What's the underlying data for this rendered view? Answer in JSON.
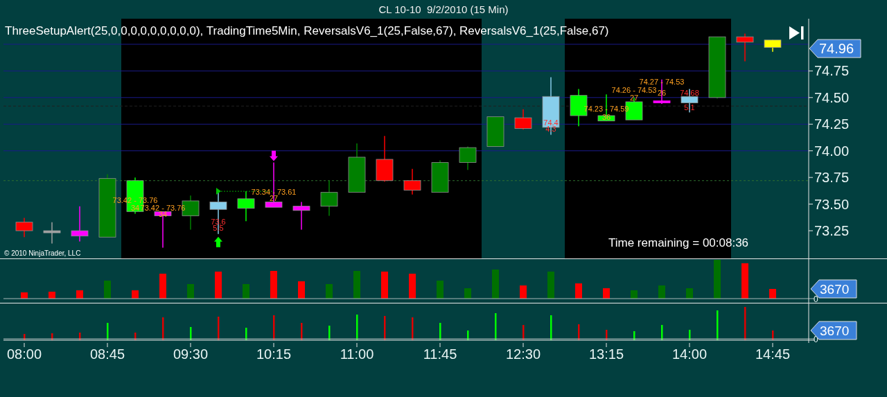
{
  "window": {
    "title": "CL 10-10  9/2/2010 (15 Min)"
  },
  "price_panel": {
    "indicators": "ThreeSetupAlert(25,0,0,0,0,0,0,0,0,0),  TradingTime5Min,  ReversalsV6_1(25,False,67),  ReversalsV6_1(25,False,67)",
    "price_axis": [
      "74.75",
      "74.50",
      "74.25",
      "74.00",
      "73.75",
      "73.50",
      "73.25"
    ],
    "last_price": "74.96",
    "timer": "Time remaining = 00:08:36",
    "copyright": "© 2010 NinjaTrader, LLC",
    "candles": [
      {
        "kind": "plain",
        "color": "#ff0000",
        "shaded": false
      },
      {
        "kind": "plain",
        "color": "#a0a0a0",
        "shaded": false
      },
      {
        "kind": "plain",
        "color": "#ff00ff",
        "shaded": false
      },
      {
        "kind": "plain",
        "color": "#008000",
        "shaded": false
      },
      {
        "kind": "plain",
        "color": "#00ff00",
        "shaded": true,
        "notes": [
          {
            "text": "73.42 - 73.76",
            "kind": "range"
          },
          {
            "text": "34",
            "kind": "count"
          }
        ]
      },
      {
        "kind": "plain",
        "color": "#ff00ff",
        "shaded": true,
        "notes": [
          {
            "text": "73.42 - 73.76",
            "kind": "range"
          },
          {
            "text": "34",
            "kind": "count"
          }
        ]
      },
      {
        "kind": "plain",
        "color": "#008000",
        "shaded": true
      },
      {
        "kind": "up",
        "color": "#87ceeb",
        "shaded": true,
        "notes": [
          {
            "text": "73.6",
            "kind": "price"
          },
          {
            "text": "5.5",
            "kind": "size"
          }
        ]
      },
      {
        "kind": "plain",
        "color": "#00ff00",
        "shaded": true
      },
      {
        "kind": "down",
        "color": "#ff00ff",
        "shaded": true,
        "notes": [
          {
            "text": "73.34 - 73.61",
            "kind": "range"
          },
          {
            "text": "27",
            "kind": "count"
          }
        ]
      },
      {
        "kind": "plain",
        "color": "#ff00ff",
        "shaded": true
      },
      {
        "kind": "plain",
        "color": "#008000",
        "shaded": true
      },
      {
        "kind": "plain",
        "color": "#008000",
        "shaded": true
      },
      {
        "kind": "plain",
        "color": "#ff0000",
        "shaded": true
      },
      {
        "kind": "plain",
        "color": "#ff0000",
        "shaded": true
      },
      {
        "kind": "plain",
        "color": "#008000",
        "shaded": true
      },
      {
        "kind": "plain",
        "color": "#008000",
        "shaded": true
      },
      {
        "kind": "plain",
        "color": "#008000",
        "shaded": false
      },
      {
        "kind": "plain",
        "color": "#ff0000",
        "shaded": false
      },
      {
        "kind": "plain",
        "color": "#87ceeb",
        "shaded": false,
        "notes": [
          {
            "text": "74.4",
            "kind": "price"
          },
          {
            "text": "4.3",
            "kind": "size"
          }
        ]
      },
      {
        "kind": "plain",
        "color": "#00ff00",
        "shaded": true
      },
      {
        "kind": "plain",
        "color": "#00ff00",
        "shaded": true,
        "notes": [
          {
            "text": "74.23 - 74.59",
            "kind": "range"
          },
          {
            "text": "36",
            "kind": "count"
          }
        ]
      },
      {
        "kind": "plain",
        "color": "#00ff00",
        "shaded": true,
        "notes": [
          {
            "text": "74.26 - 74.53",
            "kind": "range"
          },
          {
            "text": "27",
            "kind": "count"
          }
        ]
      },
      {
        "kind": "plain",
        "color": "#ff00ff",
        "shaded": true,
        "notes": [
          {
            "text": "74.27 - 74.53",
            "kind": "range"
          },
          {
            "text": "26",
            "kind": "count"
          }
        ]
      },
      {
        "kind": "plain",
        "color": "#87ceeb",
        "shaded": true,
        "notes": [
          {
            "text": "74.68",
            "kind": "price"
          },
          {
            "text": "5.1",
            "kind": "size"
          }
        ]
      },
      {
        "kind": "plain",
        "color": "#008000",
        "shaded": true
      },
      {
        "kind": "plain",
        "color": "#ff0000",
        "shaded": false
      },
      {
        "kind": "plain",
        "color": "#ffff00",
        "shaded": false
      }
    ]
  },
  "volume_panels": [
    {
      "kind": "bars",
      "value_label": "3670",
      "zero_label": "0"
    },
    {
      "kind": "sticks",
      "value_label": "3670",
      "zero_label": "0"
    }
  ],
  "time_axis": [
    "08:00",
    "08:45",
    "09:30",
    "10:15",
    "11:00",
    "11:45",
    "12:30",
    "13:15",
    "14:00",
    "14:45"
  ]
}
